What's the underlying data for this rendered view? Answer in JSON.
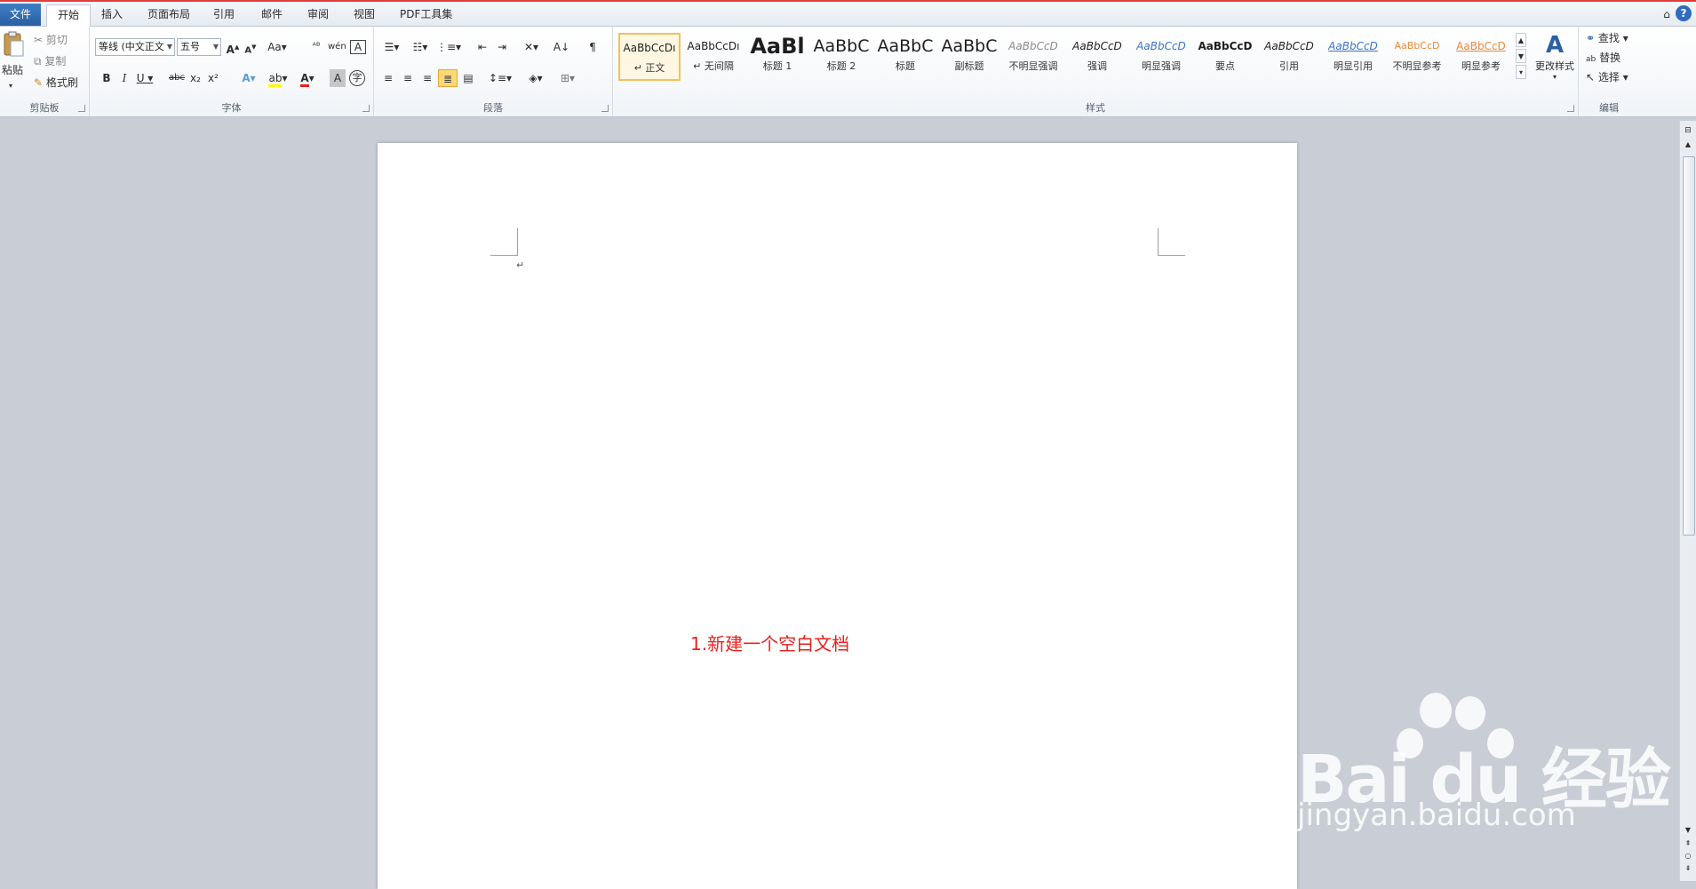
{
  "tabs": [
    "文件",
    "开始",
    "插入",
    "页面布局",
    "引用",
    "邮件",
    "审阅",
    "视图",
    "PDF工具集"
  ],
  "clipboard": {
    "paste_label": "粘贴",
    "cut_label": "剪切",
    "copy_label": "复制",
    "format_painter_label": "格式刷",
    "group_label": "剪贴板"
  },
  "font": {
    "font_name": "等线 (中文正文",
    "font_size": "五号",
    "group_label": "字体"
  },
  "paragraph": {
    "group_label": "段落"
  },
  "styles": {
    "items": [
      {
        "sample": "AaBbCcDı",
        "name": "正文"
      },
      {
        "sample": "AaBbCcDı",
        "name": "无间隔"
      },
      {
        "sample": "AaBl",
        "name": "标题 1"
      },
      {
        "sample": "AaBbC",
        "name": "标题 2"
      },
      {
        "sample": "AaBbC",
        "name": "标题"
      },
      {
        "sample": "AaBbC",
        "name": "副标题"
      },
      {
        "sample": "AaBbCcD",
        "name": "不明显强调"
      },
      {
        "sample": "AaBbCcD",
        "name": "强调"
      },
      {
        "sample": "AaBbCcD",
        "name": "明显强调"
      },
      {
        "sample": "AaBbCcD",
        "name": "要点"
      },
      {
        "sample": "AaBbCcD",
        "name": "引用"
      },
      {
        "sample": "AaBbCcD",
        "name": "明显引用"
      },
      {
        "sample": "AaBbCcD",
        "name": "不明显参考"
      },
      {
        "sample": "AaBbCcD",
        "name": "明显参考"
      }
    ],
    "change_styles_label": "更改样式",
    "group_label": "样式"
  },
  "editing": {
    "find_label": "查找",
    "replace_label": "替换",
    "select_label": "选择",
    "group_label": "编辑"
  },
  "document": {
    "text": "1.新建一个空白文档"
  },
  "watermark": {
    "logo_text": "Bai du 经验",
    "url": "jingyan.baidu.com"
  },
  "colors": {
    "accent_file_tab": "#2b5fa3",
    "doc_text_red": "#e8201d",
    "selected_style_border": "#f1c15b"
  }
}
